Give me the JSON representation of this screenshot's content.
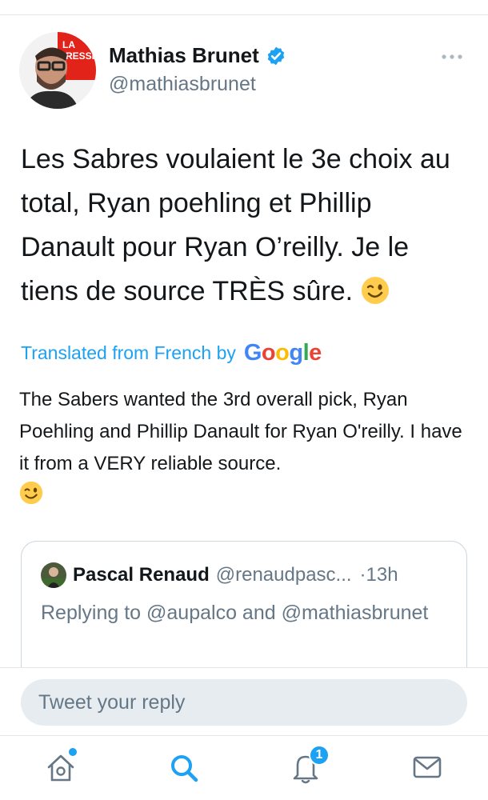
{
  "tweet": {
    "author_name": "Mathias Brunet",
    "author_handle": "@mathiasbrunet",
    "avatar_logo_text": "LA PRESSE",
    "text": "Les Sabres voulaient le 3e choix au total, Ryan poehling et Phillip Danault pour Ryan O’reilly. Je le tiens de source TRÈS sûre.",
    "emoji": "winking-face",
    "translated_label": "Translated from French by",
    "translation_provider": "Google",
    "translation": "The Sabers wanted the 3rd overall pick, Ryan Poehling and Phillip Danault for Ryan O'reilly. I have it from a VERY reliable source."
  },
  "quoted_tweet": {
    "author_name": "Pascal Renaud",
    "author_handle": "@renaudpasc...",
    "time": "·13h",
    "replying_to": "Replying to @aupalco and @mathiasbrunet"
  },
  "reply_bar": {
    "placeholder": "Tweet your reply"
  },
  "tabbar": {
    "notification_count": "1",
    "icons": [
      "home-icon",
      "search-icon",
      "bell-icon",
      "mail-icon"
    ]
  },
  "colors": {
    "accent": "#1da1f2",
    "text": "#14171a",
    "secondary": "#657786",
    "border": "#e1e8ed"
  }
}
